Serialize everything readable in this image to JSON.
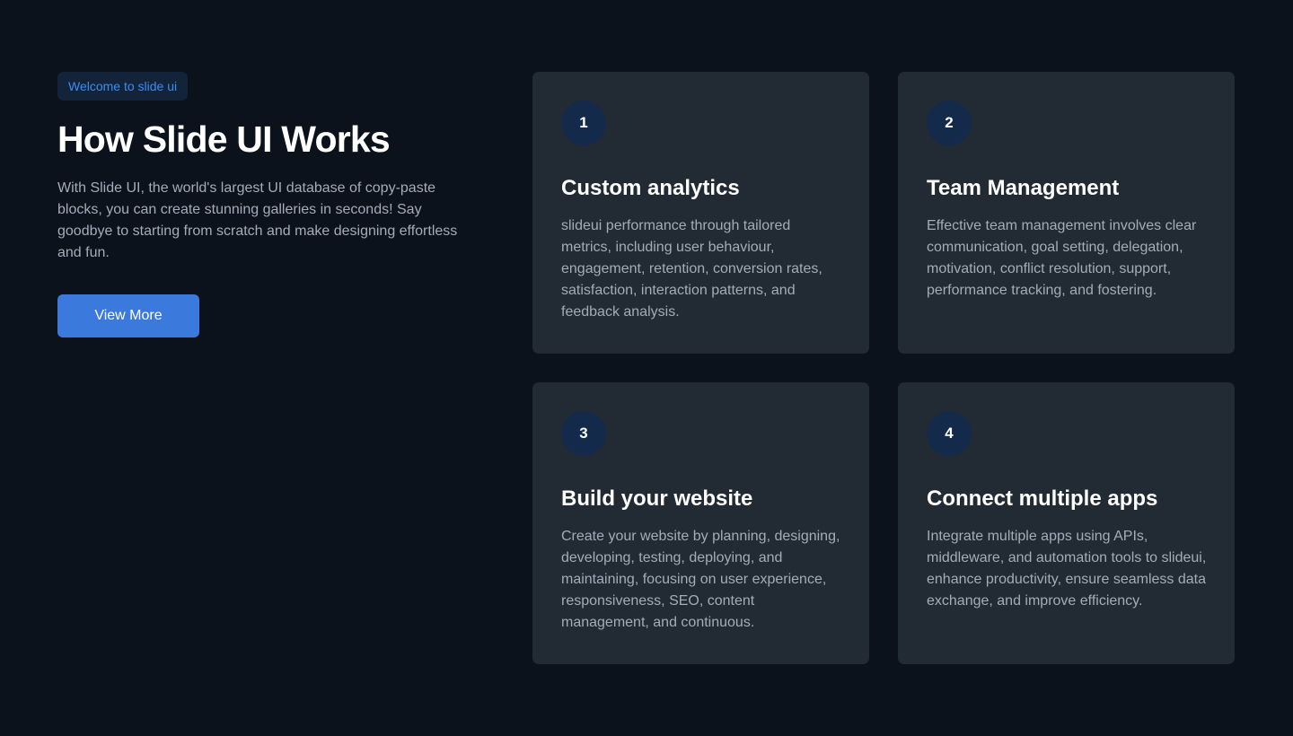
{
  "intro": {
    "badge": "Welcome to slide ui",
    "title": "How Slide UI Works",
    "description": "With Slide UI, the world's largest UI database of copy-paste blocks, you can create stunning galleries in seconds! Say goodbye to starting from scratch and make designing effortless and fun.",
    "button_label": "View More"
  },
  "cards": [
    {
      "number": "1",
      "title": "Custom analytics",
      "text": "slideui performance through tailored metrics, including user behaviour, engagement, retention, conversion rates, satisfaction, interaction patterns, and feedback analysis."
    },
    {
      "number": "2",
      "title": "Team Management",
      "text": "Effective team management involves clear communication, goal setting, delegation, motivation, conflict resolution, support, performance tracking, and fostering."
    },
    {
      "number": "3",
      "title": "Build your website",
      "text": "Create your website by planning, designing, developing, testing, deploying, and maintaining, focusing on user experience, responsiveness, SEO, content management, and continuous."
    },
    {
      "number": "4",
      "title": "Connect multiple apps",
      "text": "Integrate multiple apps using APIs, middleware, and automation tools to slideui, enhance productivity, ensure seamless data exchange, and improve efficiency."
    }
  ],
  "colors": {
    "background": "#0c121c",
    "card": "#222a33",
    "accent": "#3b79dc",
    "badge_text": "#3a8ef0",
    "number_circle": "#142a4a"
  }
}
